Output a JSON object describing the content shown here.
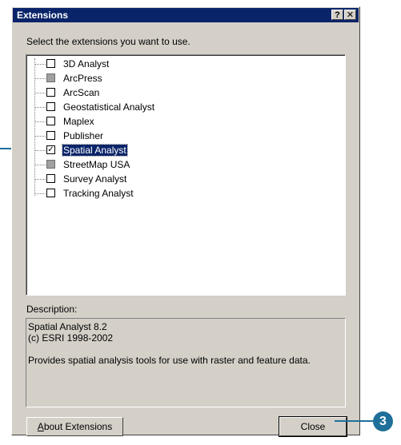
{
  "window": {
    "title": "Extensions",
    "help_button": "?",
    "close_button": "✕"
  },
  "prompt": "Select the extensions you want to use.",
  "extensions": [
    {
      "label": "3D Analyst",
      "checked": false,
      "enabled": true
    },
    {
      "label": "ArcPress",
      "checked": false,
      "enabled": false
    },
    {
      "label": "ArcScan",
      "checked": false,
      "enabled": true
    },
    {
      "label": "Geostatistical Analyst",
      "checked": false,
      "enabled": true
    },
    {
      "label": "Maplex",
      "checked": false,
      "enabled": true
    },
    {
      "label": "Publisher",
      "checked": false,
      "enabled": true
    },
    {
      "label": "Spatial Analyst",
      "checked": true,
      "enabled": true,
      "selected": true
    },
    {
      "label": "StreetMap USA",
      "checked": false,
      "enabled": false
    },
    {
      "label": "Survey Analyst",
      "checked": false,
      "enabled": true
    },
    {
      "label": "Tracking Analyst",
      "checked": false,
      "enabled": true
    }
  ],
  "description": {
    "label": "Description:",
    "line1": "Spatial Analyst 8.2",
    "line2": "(c) ESRI 1998-2002",
    "line3": "Provides spatial analysis tools for use with raster and feature data."
  },
  "buttons": {
    "about_mnemonic": "A",
    "about_rest": "bout Extensions",
    "close": "Close"
  },
  "callouts": {
    "step_close": "3"
  },
  "colors": {
    "dialog_bg": "#d4d0c8",
    "titlebar": "#0a246a",
    "callout": "#1f6f9a"
  }
}
